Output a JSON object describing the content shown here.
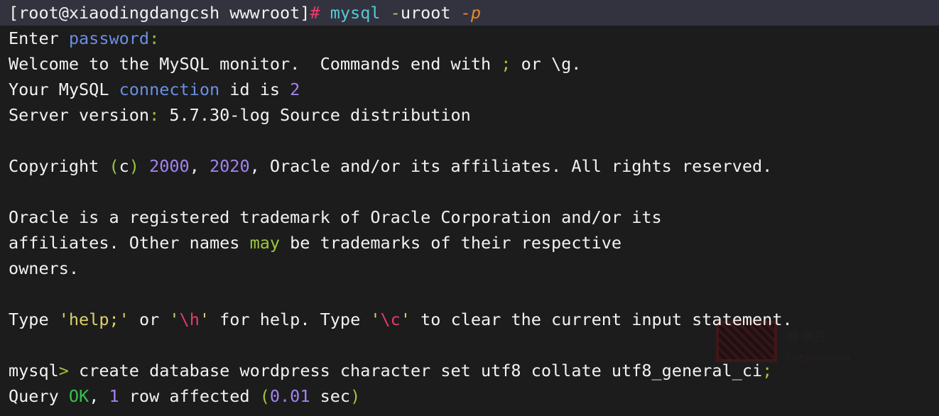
{
  "terminal": {
    "background": "#1c1c1c",
    "prompt_line_background": "#32333e",
    "foreground": "#f2f2f2",
    "lines": {
      "l1": {
        "prompt": "[root@xiaodingdangcsh wwwroot]",
        "hash": "#",
        "space1": " ",
        "command": "mysql",
        "space2": " ",
        "dash1": "-",
        "user": "uroot",
        "space3": " ",
        "flag_p": "-p"
      },
      "l2": {
        "enter": "Enter ",
        "password": "password",
        "colon": ":"
      },
      "l3": {
        "part1": "Welcome to the MySQL monitor.  Commands end with ",
        "semicolon": ";",
        "part2": " or \\g."
      },
      "l4": {
        "part1": "Your MySQL ",
        "connection": "connection",
        "part2": " id is ",
        "id": "2"
      },
      "l5": {
        "part1": "Server version",
        "colon": ":",
        "part2": " 5.7.30-log Source distribution"
      },
      "l6": "",
      "l7": {
        "part1": "Copyright ",
        "paren_open": "(",
        "c": "c",
        "paren_close": ")",
        "space": " ",
        "year1": "2000",
        "comma1": ", ",
        "year2": "2020",
        "part2": ", Oracle and/or its affiliates. All rights reserved."
      },
      "l8": "",
      "l9": "Oracle is a registered trademark of Oracle Corporation and/or its",
      "l10": {
        "part1": "affiliates. Other names ",
        "may": "may",
        "part2": " be trademarks of their respective"
      },
      "l11": "owners.",
      "l12": "",
      "l13": {
        "type1": "Type ",
        "help_quoted": "'help;'",
        "or": " or ",
        "q1": "'",
        "h_esc": "\\h",
        "q2": "'",
        "mid": " for help. Type ",
        "q3": "'",
        "c_esc": "\\c",
        "q4": "'",
        "tail": " to clear the current input statement."
      },
      "l14": "",
      "l15": {
        "mysql": "mysql",
        "gt": ">",
        "sql": " create database wordpress character set utf8 collate utf8_general_ci",
        "semicolon": ";"
      },
      "l16": {
        "query": "Query ",
        "ok": "OK",
        "comma": ", ",
        "rows": "1",
        "affected": " row affected ",
        "paren_open": "(",
        "time": "0.01",
        "sec": " sec",
        "paren_close": ")"
      }
    }
  },
  "watermark": {
    "seal_label": "seal-stamp",
    "text": "程序员",
    "subtext": "CHENGXUYUAN"
  },
  "colors": {
    "white": "#f2f2f2",
    "cyan": "#56c8d8",
    "blue": "#6a8fe0",
    "olive_green": "#9fc53d",
    "bright_green": "#35c24a",
    "purple": "#a383f0",
    "pink": "#e83e69",
    "yellow": "#ddd06a",
    "orange": "#e8892a",
    "prompt_bg": "#32333e",
    "terminal_bg": "#1c1c1c"
  }
}
